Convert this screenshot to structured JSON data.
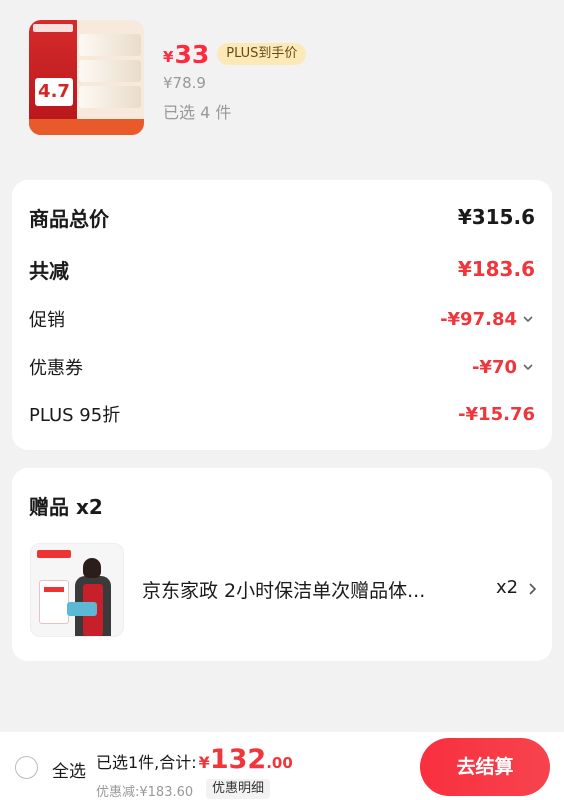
{
  "product": {
    "image_icon": "tissue-product-image",
    "thumb_number": "4.7",
    "price_symbol": "¥",
    "price": "33",
    "plus_badge": "PLUS到手价",
    "original_price": "¥78.9",
    "selected_count": "已选 4 件"
  },
  "summary": {
    "rows": [
      {
        "label": "商品总价",
        "value": "¥315.6"
      },
      {
        "label": "共减",
        "value": "¥183.6"
      },
      {
        "label": "促销",
        "value": "-¥97.84"
      },
      {
        "label": "优惠券",
        "value": "-¥70"
      },
      {
        "label": "PLUS 95折",
        "value": "-¥15.76"
      }
    ]
  },
  "gift": {
    "title": "赠品 x2",
    "name": "京东家政 2小时保洁单次赠品体...",
    "qty": "x2"
  },
  "bottom": {
    "select_all": "全选",
    "total_prefix": "已选1件,合计:",
    "total_symbol": "¥",
    "total_int": "132",
    "total_dec": ".00",
    "discount": "优惠减:¥183.60",
    "detail_label": "优惠明细",
    "checkout_label": "去结算"
  },
  "colors": {
    "accent_red": "#f0353b",
    "plus_gold": "#fde9b8"
  }
}
